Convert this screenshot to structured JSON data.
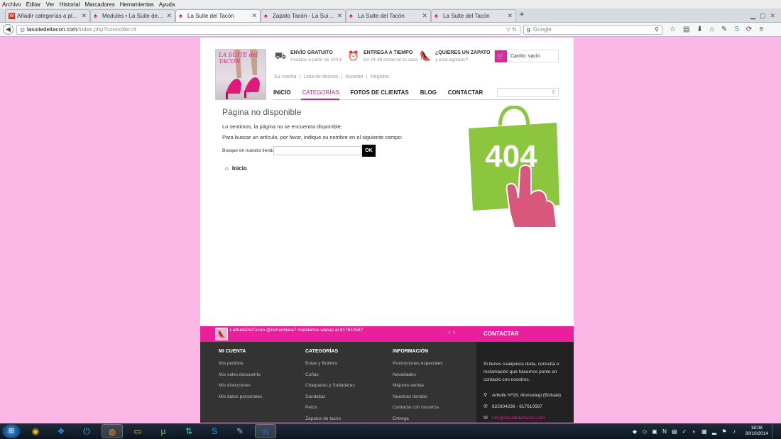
{
  "menubar": [
    "Archivo",
    "Editar",
    "Ver",
    "Historial",
    "Marcadores",
    "Herramientas",
    "Ayuda"
  ],
  "tabs": [
    {
      "title": "Añadir categorías a plantill...",
      "active": false,
      "icon": "w-icon"
    },
    {
      "title": "Modules • La Suite del Tac...",
      "active": false,
      "icon": "shoe-icon"
    },
    {
      "title": "La Suite del Tacón",
      "active": true,
      "icon": "shoe-icon"
    },
    {
      "title": "Zapato Tacón - La Suite de...",
      "active": false,
      "icon": "shoe-icon"
    },
    {
      "title": "La Suite del Tacón",
      "active": false,
      "icon": "shoe-icon"
    },
    {
      "title": "La Suite del Tacón",
      "active": false,
      "icon": "shoe-icon"
    }
  ],
  "address": {
    "domain": "lasuitedeltacon.com",
    "path": "/index.php?controller=#"
  },
  "search": {
    "placeholder": "Google"
  },
  "header": {
    "logo_text": "LA SUITE del TACON",
    "info": [
      {
        "title": "ENVÍO GRATUITO",
        "sub": "Pedidos a partir de 100 €",
        "icon": "truck-icon"
      },
      {
        "title": "ENTREGA A TIEMPO",
        "sub": "En 24-48 horas en tu casa",
        "icon": "alarm-clock-icon"
      },
      {
        "title": "¿QUIERES UN ZAPATO",
        "sub": "y está agotado?",
        "icon": "heel-shoe-icon"
      }
    ],
    "cart_label": "Carrito: vacío",
    "account_links": [
      "Su cuenta",
      "Lista de deseos",
      "Acceder",
      "Registro"
    ]
  },
  "nav": {
    "items": [
      "INICIO",
      "CATEGORÍAS",
      "FOTOS DE CLIENTAS",
      "BLOG",
      "CONTACTAR"
    ],
    "active_index": 1
  },
  "content": {
    "title": "Página no disponible",
    "p1": "Lo sentimos, la página no se encuentra disponible.",
    "p2": "Para buscar un artículo, por favor, indique su nombre en el siguiente campo:",
    "search_label": "Busque en nuestra tienda:",
    "ok_label": "OK",
    "breadcrumb": "Inicio",
    "error_code": "404"
  },
  "twitter_strip": {
    "text": "LaSuiteDelTacon @nohemilara7 mándanos wasap al 617610587",
    "contact_label": "CONTACTAR"
  },
  "footer": {
    "columns": [
      {
        "heading": "MI CUENTA",
        "items": [
          "Mis pedidos",
          "Mis vales descuento",
          "Mis direcciones",
          "Mis datos personales"
        ]
      },
      {
        "heading": "CATEGORÍAS",
        "items": [
          "Botas y Botines",
          "Cuñas",
          "Chaquetas y Sudaderas",
          "Sandalias",
          "Petos",
          "Zapatos de tacón"
        ]
      },
      {
        "heading": "INFORMACIÓN",
        "items": [
          "Promociones especiales",
          "Novedades",
          "Mejores ventas",
          "Nuestras tiendas",
          "Contacte con nosotros",
          "Entrega"
        ]
      }
    ],
    "contact": {
      "description": "Si tienes cualquiera duda, consulta o reclamación que hacernos ponte en contacto con nosotros.",
      "address": "Arbullo Nº18, Alonsotegi (Bizkaia)",
      "phone": "622604236 - 617610587",
      "email": "info@lasuitedeltacon.com"
    }
  },
  "taskbar": {
    "time": "18:08",
    "date": "30/10/2014"
  },
  "colors": {
    "brand_pink": "#ea1f9c",
    "page_background": "#fbb8e6",
    "bag_green": "#8cc63f",
    "hand_pink": "#d9567c"
  }
}
